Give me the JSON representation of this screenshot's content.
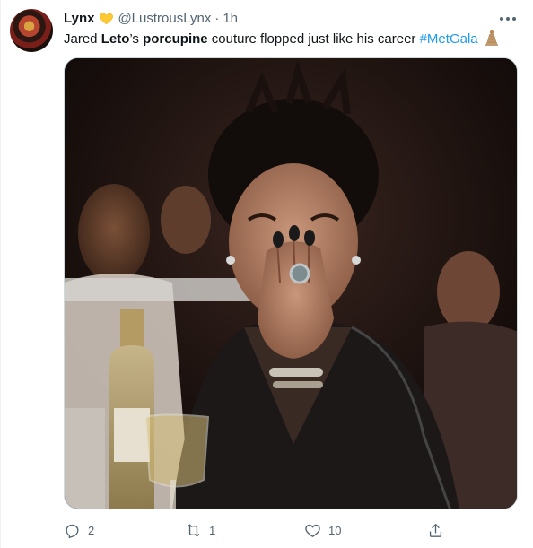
{
  "author": {
    "name": "Lynx",
    "handle": "@LustrousLynx",
    "separator": "·",
    "time": "1h",
    "badge_icon": "yellow-heart-icon",
    "avatar_icon": "profile-avatar-image"
  },
  "tweet": {
    "text_1": "Jared ",
    "text_bold_1": "Leto",
    "text_2": "’s ",
    "text_bold_2": "porcupine",
    "text_3": " couture flopped just like his career ",
    "hashtag": "#MetGala",
    "hashtag_emoji_icon": "met-gala-emoji-icon",
    "media_icon": "photo-woman-laughing-covering-mouth"
  },
  "actions": {
    "reply_count": "2",
    "retweet_count": "1",
    "like_count": "10",
    "share_icon": "share-icon"
  },
  "colors": {
    "link": "#1d9bf0",
    "secondary_text": "#536471",
    "primary_text": "#0f1419",
    "border": "#cfd9de"
  }
}
